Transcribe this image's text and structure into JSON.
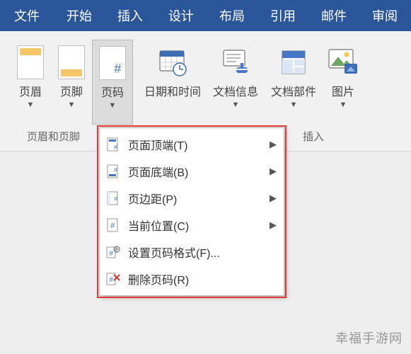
{
  "tabs": {
    "file": "文件",
    "items": [
      "开始",
      "插入",
      "设计",
      "布局",
      "引用",
      "邮件",
      "审阅"
    ]
  },
  "ribbon": {
    "buttons": {
      "header": "页眉",
      "footer": "页脚",
      "pagenum": "页码",
      "datetime": "日期和时间",
      "docinfo": "文档信息",
      "docparts": "文档部件",
      "picture": "图片"
    },
    "group_hf": "页眉和页脚",
    "group_insert": "插入"
  },
  "menu": {
    "top": "页面顶端(T)",
    "bottom": "页面底端(B)",
    "margins": "页边距(P)",
    "current": "当前位置(C)",
    "format": "设置页码格式(F)...",
    "remove": "删除页码(R)"
  },
  "watermark": "幸福手游网"
}
